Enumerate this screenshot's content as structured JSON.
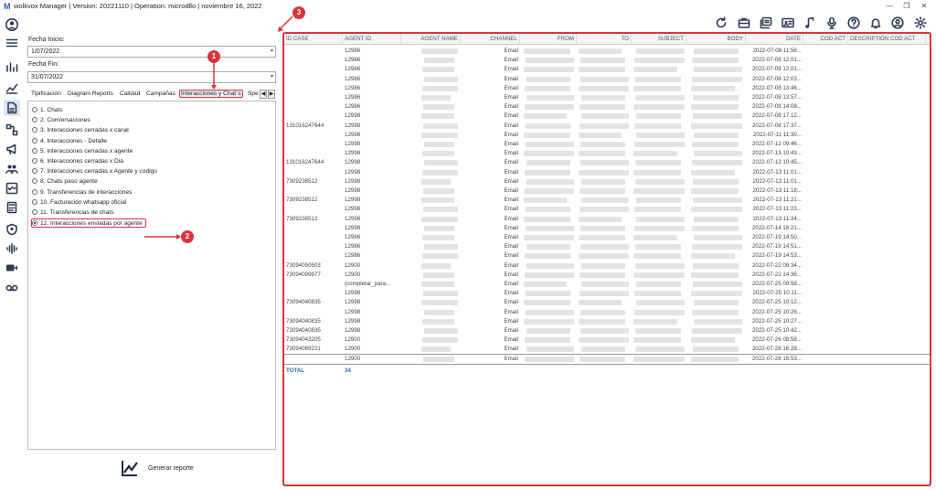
{
  "window": {
    "title": "wolkvox Manager  | Version: 20221110  |  Operation: microdllo  | noviembre 16, 2022",
    "controls": [
      "—",
      "❐",
      "✕"
    ]
  },
  "left_nav": {
    "icons": [
      "user-icon",
      "menu-icon",
      "bar-chart-icon",
      "trend-icon",
      "reports-icon",
      "flow-icon",
      "megaphone-icon",
      "agents-icon",
      "checklist-icon",
      "calculator-icon",
      "shield-icon",
      "voice-icon",
      "video-icon",
      "voicemail-icon"
    ]
  },
  "toolbar": {
    "icons": [
      "refresh-icon",
      "briefcase-icon",
      "gallery-icon",
      "contact-card-icon",
      "music-icon",
      "microphone-icon",
      "help-icon",
      "bell-icon",
      "account-icon",
      "settings-icon"
    ]
  },
  "filters": {
    "start_label": "Fecha Inicio:",
    "start_value": "1/07/2022",
    "end_label": "Fecha Fin:",
    "end_value": "31/07/2022"
  },
  "tabs": [
    {
      "label": "Tipificación"
    },
    {
      "label": "Diagram Reports"
    },
    {
      "label": "Calidad"
    },
    {
      "label": "Campañas"
    },
    {
      "label": "Interacciones y Chat´s",
      "active": true
    },
    {
      "label": "Spe"
    }
  ],
  "tab_scroll": {
    "left": "◀",
    "right": "▶"
  },
  "reports": [
    "1. Chats",
    "2. Conversaciones",
    "3. Interacciones cerradas x canal",
    "4. Interacciones - Detalle",
    "5. Interacciones cerradas x agente",
    "6. Interacciones cerradas x Dia",
    "7. Interacciones cerradas x Agente y codigo",
    "8. Chats paso agente",
    "9. Transferencias de interacciones",
    "10. Facturación whatsapp oficial",
    "11. Transferencias de chats",
    "12. Interacciones enviadas por agente"
  ],
  "selected_report_index": 11,
  "generate_label": "Generar reporte",
  "callouts": [
    "1",
    "2",
    "3"
  ],
  "grid": {
    "columns": [
      "ID CASE",
      "AGENT ID",
      "AGENT NAME",
      "CHANNEL",
      "FROM",
      "TO",
      "SUBJECT",
      "BODY",
      "DATE",
      "COD ACT",
      "DESCRIPTION COD ACT"
    ],
    "rows": [
      {
        "id_case": "",
        "agent_id": "12986",
        "channel": "Email",
        "date": "2022-07-08 11:56..."
      },
      {
        "id_case": "",
        "agent_id": "12986",
        "channel": "Email",
        "date": "2022-07-08 12:01..."
      },
      {
        "id_case": "",
        "agent_id": "12986",
        "channel": "Email",
        "date": "2022-07-08 12:01..."
      },
      {
        "id_case": "",
        "agent_id": "12986",
        "channel": "Email",
        "date": "2022-07-08 12:03..."
      },
      {
        "id_case": "",
        "agent_id": "12986",
        "channel": "Email",
        "date": "2022-07-08 13:46..."
      },
      {
        "id_case": "",
        "agent_id": "12986",
        "channel": "Email",
        "date": "2022-07-08 13:57..."
      },
      {
        "id_case": "",
        "agent_id": "12986",
        "channel": "Email",
        "date": "2022-07-08 14:08..."
      },
      {
        "id_case": "",
        "agent_id": "12998",
        "channel": "Email",
        "date": "2022-07-08 17:12..."
      },
      {
        "id_case": "131016247644",
        "agent_id": "12998",
        "channel": "Email",
        "date": "2022-07-08 17:37..."
      },
      {
        "id_case": "",
        "agent_id": "12998",
        "channel": "Email",
        "date": "2022-07-11 11:30..."
      },
      {
        "id_case": "",
        "agent_id": "12998",
        "channel": "Email",
        "date": "2022-07-12 09:46..."
      },
      {
        "id_case": "",
        "agent_id": "12998",
        "channel": "Email",
        "date": "2022-07-13 10:43..."
      },
      {
        "id_case": "131016247644",
        "agent_id": "12998",
        "channel": "Email",
        "date": "2022-07-13 10:45..."
      },
      {
        "id_case": "",
        "agent_id": "12998",
        "channel": "Email",
        "date": "2022-07-13 11:01..."
      },
      {
        "id_case": "7309238512",
        "agent_id": "12998",
        "channel": "Email",
        "date": "2022-07-13 11:01..."
      },
      {
        "id_case": "",
        "agent_id": "12998",
        "channel": "Email",
        "date": "2022-07-13 11:18..."
      },
      {
        "id_case": "7309238512",
        "agent_id": "12998",
        "channel": "Email",
        "date": "2022-07-13 11:21..."
      },
      {
        "id_case": "",
        "agent_id": "12998",
        "channel": "Email",
        "date": "2022-07-13 11:23..."
      },
      {
        "id_case": "7309238512",
        "agent_id": "12998",
        "channel": "Email",
        "date": "2022-07-13 11:24..."
      },
      {
        "id_case": "",
        "agent_id": "12998",
        "channel": "Email",
        "date": "2022-07-14 16:21..."
      },
      {
        "id_case": "",
        "agent_id": "12986",
        "channel": "Email",
        "date": "2022-07-19 14:50..."
      },
      {
        "id_case": "",
        "agent_id": "12986",
        "channel": "Email",
        "date": "2022-07-19 14:51..."
      },
      {
        "id_case": "",
        "agent_id": "12986",
        "channel": "Email",
        "date": "2022-07-19 14:53..."
      },
      {
        "id_case": "73094050503",
        "agent_id": "12900",
        "channel": "Email",
        "date": "2022-07-22 09:34..."
      },
      {
        "id_case": "73094099977",
        "agent_id": "12900",
        "channel": "Email",
        "date": "2022-07-22 14:36..."
      },
      {
        "id_case": "",
        "agent_id": "(completar_para...",
        "channel": "Email",
        "date": "2022-07-25 09:58..."
      },
      {
        "id_case": "",
        "agent_id": "12998",
        "channel": "Email",
        "date": "2022-07-25 10:11..."
      },
      {
        "id_case": "73094040835",
        "agent_id": "12998",
        "channel": "Email",
        "date": "2022-07-25 10:12..."
      },
      {
        "id_case": "",
        "agent_id": "12998",
        "channel": "Email",
        "date": "2022-07-25 10:26..."
      },
      {
        "id_case": "73094040835",
        "agent_id": "12998",
        "channel": "Email",
        "date": "2022-07-25 10:27..."
      },
      {
        "id_case": "73094040835",
        "agent_id": "12998",
        "channel": "Email",
        "date": "2022-07-25 10:42..."
      },
      {
        "id_case": "73094043205",
        "agent_id": "12900",
        "channel": "Email",
        "date": "2022-07-26 08:58..."
      },
      {
        "id_case": "73094089221",
        "agent_id": "12900",
        "channel": "Email",
        "date": "2022-07-28 16:28..."
      },
      {
        "id_case": "",
        "agent_id": "12900",
        "channel": "Email",
        "date": "2022-07-28 16:53..."
      }
    ],
    "total_label": "TOTAL",
    "total_value": "34"
  },
  "colors": {
    "accent": "#d9363e",
    "link": "#2a6bb8",
    "nav_icon": "#2d3b55"
  }
}
